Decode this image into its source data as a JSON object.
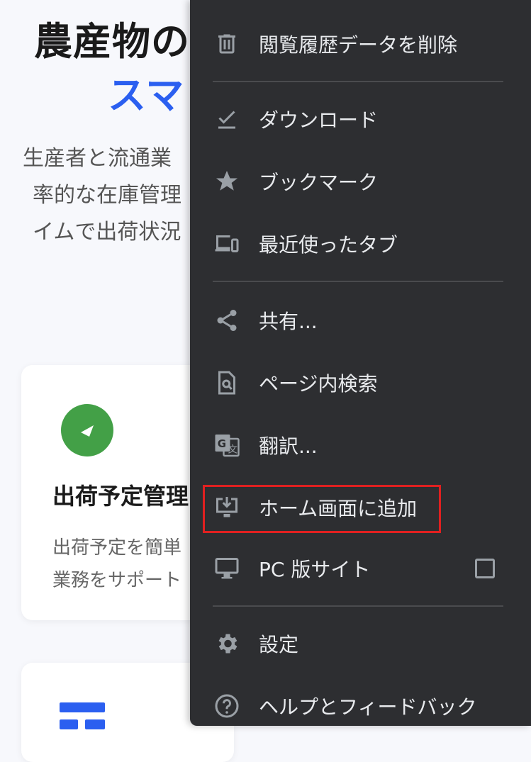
{
  "background": {
    "hero_title_line1": "農産物の",
    "hero_title_line2": "スマ",
    "hero_desc": [
      "生産者と流通業",
      "率的な在庫管理",
      "イムで出荷状況"
    ],
    "card1": {
      "title": "出荷予定管理",
      "desc": [
        "出荷予定を簡単",
        "業務をサポート"
      ]
    },
    "accent_color": "#2b5ff0"
  },
  "menu": {
    "items": [
      {
        "label": "閲覧履歴データを削除",
        "icon": "trash-icon"
      },
      {
        "label": "ダウンロード",
        "icon": "download-icon"
      },
      {
        "label": "ブックマーク",
        "icon": "star-icon"
      },
      {
        "label": "最近使ったタブ",
        "icon": "devices-icon"
      },
      {
        "label": "共有...",
        "icon": "share-icon"
      },
      {
        "label": "ページ内検索",
        "icon": "find-in-page-icon"
      },
      {
        "label": "翻訳...",
        "icon": "translate-icon"
      },
      {
        "label": "ホーム画面に追加",
        "icon": "add-to-home-screen-icon"
      },
      {
        "label": "PC 版サイト",
        "icon": "desktop-icon"
      },
      {
        "label": "設定",
        "icon": "gear-icon"
      },
      {
        "label": "ヘルプとフィードバック",
        "icon": "help-icon"
      }
    ],
    "desktop_site_checked": false,
    "highlight_color": "#e02020"
  }
}
